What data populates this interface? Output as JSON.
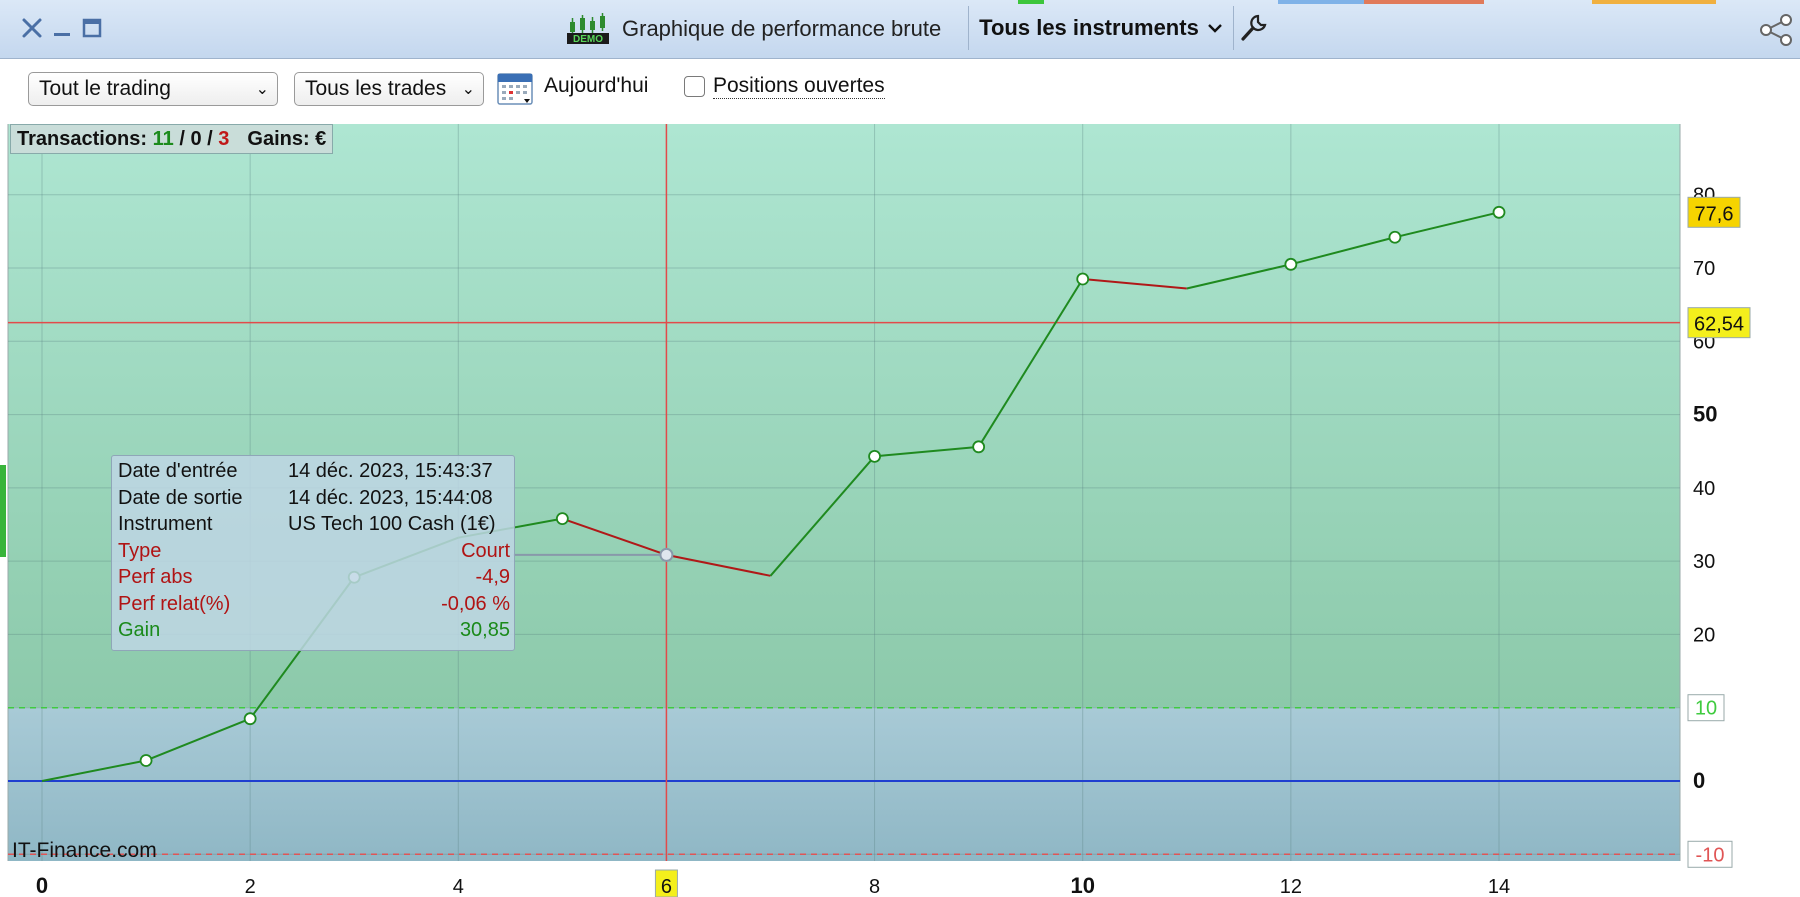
{
  "window": {
    "title": "Graphique de performance brute",
    "demo_badge": "DEMO",
    "instrument_selector": "Tous les instruments",
    "icons": [
      "close-icon",
      "minimize-icon",
      "maximize-icon",
      "demo-chart-icon",
      "chevron-down-icon",
      "wrench-icon",
      "share-icon"
    ]
  },
  "toolbar": {
    "trading_select": "Tout le trading",
    "trades_select": "Tous les trades",
    "today_label": "Aujourd'hui",
    "open_positions_label": "Positions ouvertes",
    "open_positions_checked": false
  },
  "stats": {
    "transactions_label": "Transactions:",
    "wins": "11",
    "sep1": "/",
    "neutral": "0",
    "sep2": "/",
    "losses": "3",
    "gains_label": "Gains: €"
  },
  "tooltip": {
    "rows": [
      {
        "key": "Date d'entrée",
        "value": "14 déc. 2023, 15:43:37",
        "color": "#111111"
      },
      {
        "key": "Date de sortie",
        "value": "14 déc. 2023, 15:44:08",
        "color": "#111111"
      },
      {
        "key": "Instrument",
        "value": "US Tech 100 Cash (1€)",
        "color": "#111111"
      },
      {
        "key": "Type",
        "value": "Court",
        "color": "#b01414"
      },
      {
        "key": "Perf abs",
        "value": "-4,9",
        "color": "#b01414"
      },
      {
        "key": "Perf relat(%)",
        "value": "-0,06 %",
        "color": "#b01414"
      },
      {
        "key": "Gain",
        "value": "30,85",
        "color": "#1a8a1a"
      }
    ]
  },
  "watermark": "IT-Finance.com",
  "chart_data": {
    "type": "line",
    "x": [
      0,
      1,
      2,
      3,
      4,
      5,
      6,
      7,
      8,
      9,
      10,
      11,
      12,
      13,
      14
    ],
    "values": [
      0,
      2.8,
      8.5,
      27.8,
      33.2,
      35.8,
      30.85,
      28,
      44.3,
      45.6,
      68.5,
      67.2,
      70.5,
      74.2,
      77.6
    ],
    "markers_at": [
      1,
      2,
      3,
      5,
      6,
      8,
      9,
      10,
      12,
      13,
      14
    ],
    "losing_segments": [
      [
        5,
        6
      ],
      [
        6,
        7
      ],
      [
        10,
        11
      ]
    ],
    "xlim": [
      -0.3,
      15.8
    ],
    "ylim": [
      -10.5,
      89
    ],
    "x_ticks": [
      "0",
      "2",
      "4",
      "6",
      "8",
      "10",
      "12",
      "14"
    ],
    "y_ticks": [
      "80",
      "70",
      "60",
      "50",
      "40",
      "30",
      "20",
      "10",
      "0",
      "-10"
    ],
    "bold_x_ticks": [
      "0",
      "10"
    ],
    "bold_y_ticks": [
      "50",
      "0"
    ],
    "crosshair_x": 6,
    "crosshair_x_label": "6",
    "crosshair_y": 62.54,
    "crosshair_y_label": "62,54",
    "last_value_label": "77,6",
    "upper_threshold": 10,
    "upper_threshold_label": "10",
    "lower_threshold": -10,
    "lower_threshold_label": "-10",
    "zero_line": 0,
    "grid": true,
    "colors": {
      "profit_bg_top": "#aee6d2",
      "profit_bg_bottom": "#8cc9aa",
      "loss_bg_top": "#a8cad6",
      "loss_bg_bottom": "#8fb7c5",
      "up_line": "#1f8a1f",
      "down_line": "#b01818",
      "zero_line": "#1f3fd0",
      "crosshair": "#e24a4a",
      "threshold_up": "#3fcb3f",
      "threshold_down": "#e05555",
      "label_yellow": "#f6d400",
      "label_yellow2": "#f4ef1c"
    }
  }
}
